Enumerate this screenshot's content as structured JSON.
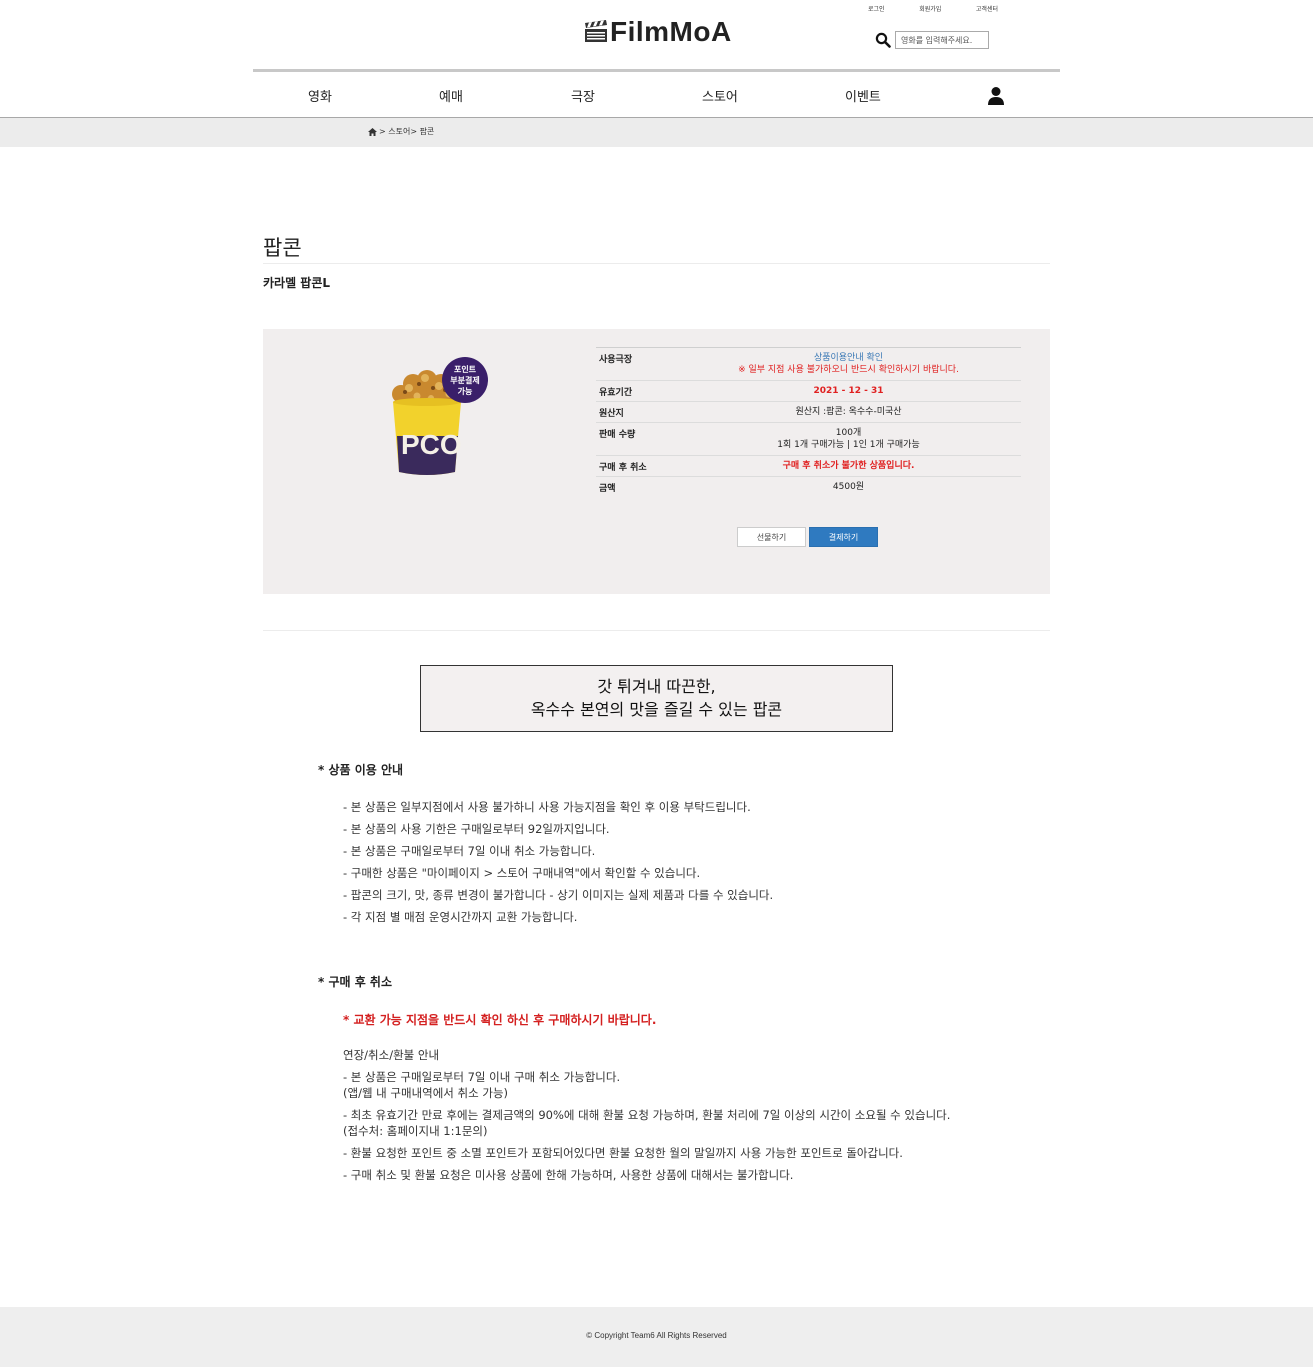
{
  "header": {
    "top_links": [
      "로그인",
      "회원가입",
      "고객센터"
    ],
    "logo_text": "FilmMoA",
    "search_placeholder": "영화를 입력해주세요."
  },
  "nav": {
    "items": [
      "영화",
      "예매",
      "극장",
      "스토어",
      "이벤트"
    ]
  },
  "breadcrumb": {
    "text": "> 스토어> 팝콘"
  },
  "page": {
    "title": "팝콘",
    "product_name": "카라멜 팝콘L"
  },
  "product": {
    "badge": [
      "포인트",
      "부분결제",
      "가능"
    ],
    "rows": [
      {
        "label": "사용극장",
        "lines": [
          "상품이용안내 확인",
          "※ 일부 지점 사용 불가하오니 반드시 확인하시기 바랍니다."
        ]
      },
      {
        "label": "유효기간",
        "lines": [
          "2021 - 12 - 31"
        ]
      },
      {
        "label": "원산지",
        "lines": [
          "원산지 :팝콘: 옥수수-미국산"
        ]
      },
      {
        "label": "판매 수량",
        "lines": [
          "100개",
          "1회 1개 구매가능 | 1인 1개 구매가능"
        ]
      },
      {
        "label": "구매 후 취소",
        "lines": [
          "구매 후 취소가 불가한 상품입니다."
        ]
      },
      {
        "label": "금액",
        "lines": [
          "4500원"
        ]
      }
    ],
    "gift_button": "선물하기",
    "pay_button": "결제하기",
    "colors": {
      "box_bg": "#f1eeee",
      "pay_button": "#2f7ac0",
      "warning_red": "#e02020",
      "link_blue": "#3a78b5"
    }
  },
  "slogan": {
    "line1": "갓 튀겨내 따끈한,",
    "line2": "옥수수 본연의 맛을 즐길 수 있는 팝콘"
  },
  "usage": {
    "title": "* 상품 이용 안내",
    "items": [
      "- 본 상품은 일부지점에서 사용 불가하니 사용 가능지점을 확인 후 이용 부탁드립니다.",
      "- 본 상품의 사용 기한은 구매일로부터 92일까지입니다.",
      "- 본 상품은 구매일로부터 7일 이내 취소 가능합니다.",
      "- 구매한 상품은 \"마이페이지 > 스토어 구매내역\"에서 확인할 수 있습니다.",
      "- 팝콘의 크기, 맛, 종류 변경이 불가합니다 - 상기 이미지는 실제 제품과 다를 수 있습니다.",
      "- 각 지점 별 매점 운영시간까지 교환 가능합니다."
    ]
  },
  "cancel": {
    "title": "* 구매 후 취소",
    "warning": "* 교환 가능 지점을 반드시 확인 하신 후 구매하시기 바랍니다.",
    "heading": "연장/취소/환불 안내",
    "items": [
      [
        "- 본 상품은 구매일로부터 7일 이내 구매 취소 가능합니다.",
        "(앱/웹 내 구매내역에서 취소 가능)"
      ],
      [
        "- 최초 유효기간 만료 후에는 결제금액의 90%에 대해 환불 요청 가능하며, 환불 처리에 7일 이상의 시간이 소요될 수 있습니다.",
        "(접수처: 홈페이지내 1:1문의)"
      ],
      [
        "- 환불 요청한 포인트 중 소멸 포인트가 포함되어있다면 환불 요청한 월의 말일까지 사용 가능한 포인트로 돌아갑니다."
      ],
      [
        "- 구매 취소 및 환불 요청은 미사용 상품에 한해 가능하며, 사용한 상품에 대해서는 불가합니다."
      ]
    ]
  },
  "footer": {
    "copyright": "© Copyright Team6 All Rights Reserved"
  }
}
